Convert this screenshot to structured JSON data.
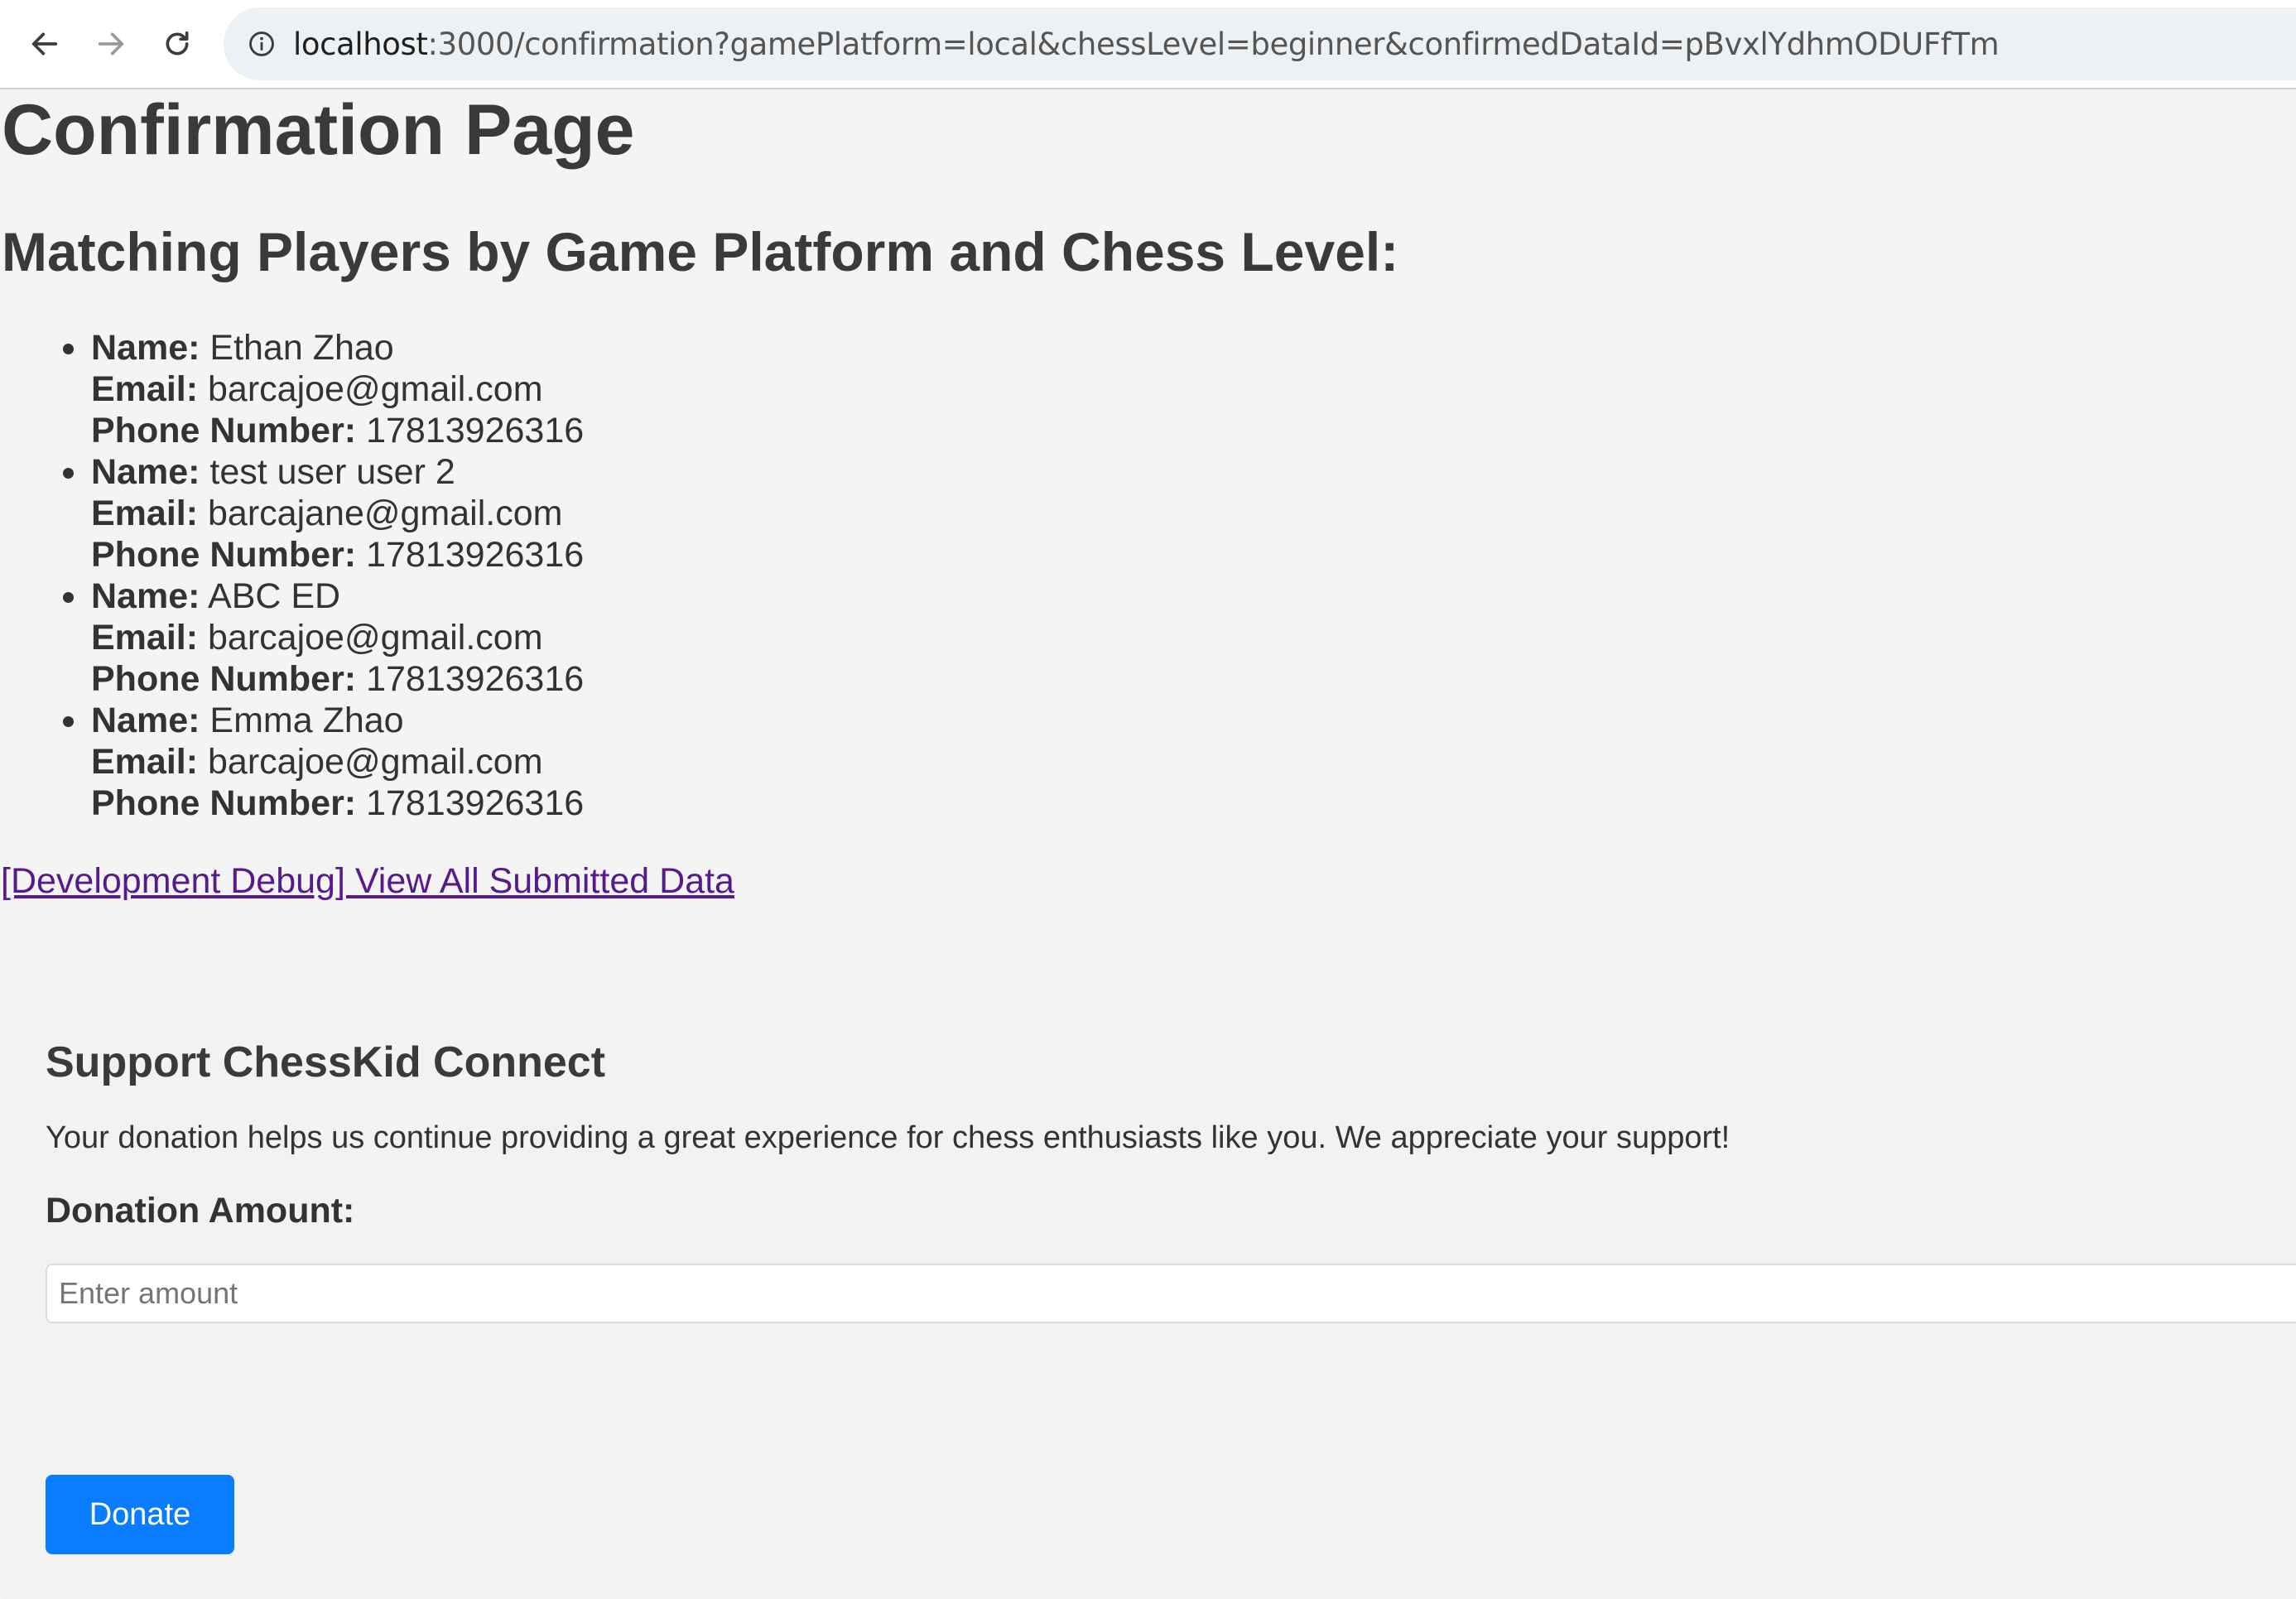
{
  "browser": {
    "url_host": "localhost",
    "url_rest": ":3000/confirmation?gamePlatform=local&chessLevel=beginner&confirmedDataId=pBvxlYdhmODUFfTm"
  },
  "page": {
    "title": "Confirmation Page",
    "subtitle": "Matching Players by Game Platform and Chess Level:"
  },
  "labels": {
    "name": "Name:",
    "email": "Email:",
    "phone": "Phone Number:"
  },
  "players": [
    {
      "name": "Ethan Zhao",
      "email": "barcajoe@gmail.com",
      "phone": "17813926316"
    },
    {
      "name": "test user user 2",
      "email": "barcajane@gmail.com",
      "phone": "17813926316"
    },
    {
      "name": "ABC ED",
      "email": "barcajoe@gmail.com",
      "phone": "17813926316"
    },
    {
      "name": "Emma Zhao",
      "email": "barcajoe@gmail.com",
      "phone": "17813926316"
    }
  ],
  "debug_link": "[Development Debug] View All Submitted Data",
  "support": {
    "heading": "Support ChessKid Connect",
    "description": "Your donation helps us continue providing a great experience for chess enthusiasts like you. We appreciate your support!",
    "amount_label": "Donation Amount:",
    "amount_placeholder": "Enter amount",
    "amount_value": "",
    "donate_label": "Donate"
  },
  "colors": {
    "link_visited": "#551a8b",
    "button_primary": "#0a7cff",
    "page_background": "#f4f4f4"
  },
  "icons": [
    "back-arrow-icon",
    "forward-arrow-icon",
    "reload-icon",
    "site-info-icon"
  ]
}
